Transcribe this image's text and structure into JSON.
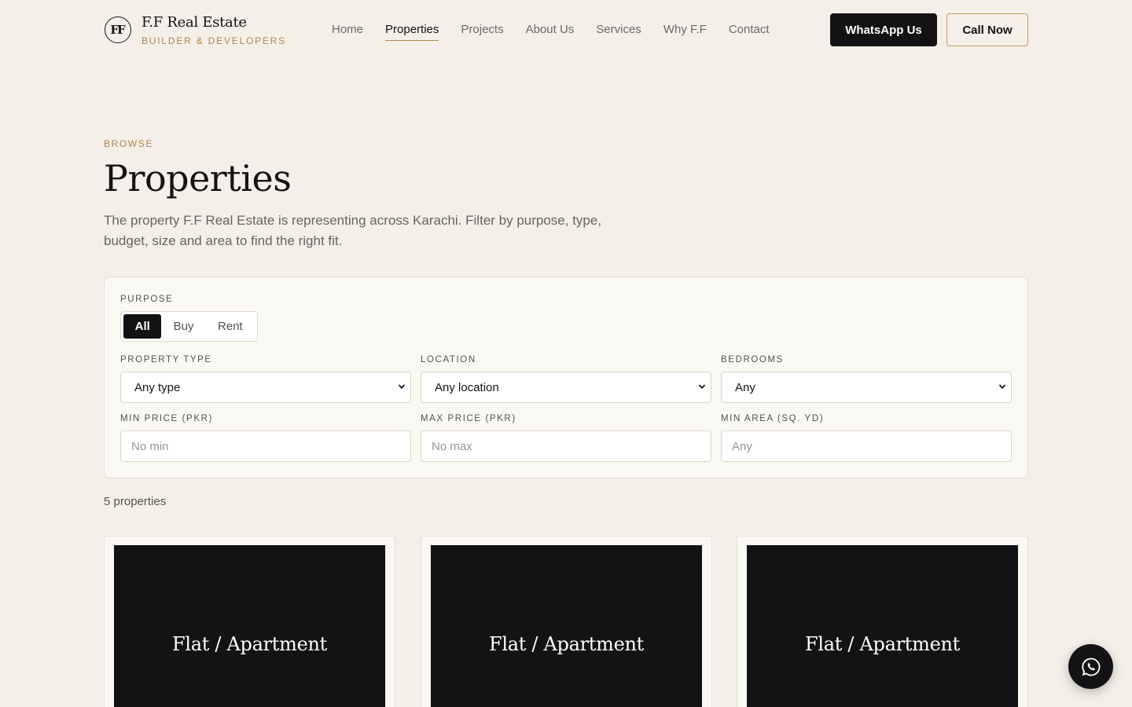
{
  "brand": {
    "mark": "FF",
    "name": "F.F Real Estate",
    "tagline": "BUILDER & DEVELOPERS"
  },
  "nav": {
    "items": [
      {
        "label": "Home",
        "active": false
      },
      {
        "label": "Properties",
        "active": true
      },
      {
        "label": "Projects",
        "active": false
      },
      {
        "label": "About Us",
        "active": false
      },
      {
        "label": "Services",
        "active": false
      },
      {
        "label": "Why F.F",
        "active": false
      },
      {
        "label": "Contact",
        "active": false
      }
    ]
  },
  "actions": {
    "whatsapp_label": "WhatsApp Us",
    "call_label": "Call Now"
  },
  "intro": {
    "eyebrow": "BROWSE",
    "title": "Properties",
    "description": "The property F.F Real Estate is representing across Karachi. Filter by purpose, type, budget, size and area to find the right fit."
  },
  "filters": {
    "purpose": {
      "label": "PURPOSE",
      "options": [
        "All",
        "Buy",
        "Rent"
      ],
      "selected": "All"
    },
    "property_type": {
      "label": "PROPERTY TYPE",
      "value": "Any type"
    },
    "location": {
      "label": "LOCATION",
      "value": "Any location"
    },
    "bedrooms": {
      "label": "BEDROOMS",
      "value": "Any"
    },
    "min_price": {
      "label": "MIN PRICE (PKR)",
      "placeholder": "No min"
    },
    "max_price": {
      "label": "MAX PRICE (PKR)",
      "placeholder": "No max"
    },
    "min_area": {
      "label": "MIN AREA (SQ. YD)",
      "placeholder": "Any"
    }
  },
  "results": {
    "count_text": "5 properties",
    "cards": [
      {
        "type": "Flat / Apartment"
      },
      {
        "type": "Flat / Apartment"
      },
      {
        "type": "Flat / Apartment"
      }
    ]
  },
  "colors": {
    "background": "#f4f0e9",
    "ink": "#131316",
    "accent": "#b28450",
    "panel": "#faf8f3"
  },
  "icons": {
    "fab": "whatsapp-icon",
    "select_arrow": "chevron-down-icon"
  }
}
